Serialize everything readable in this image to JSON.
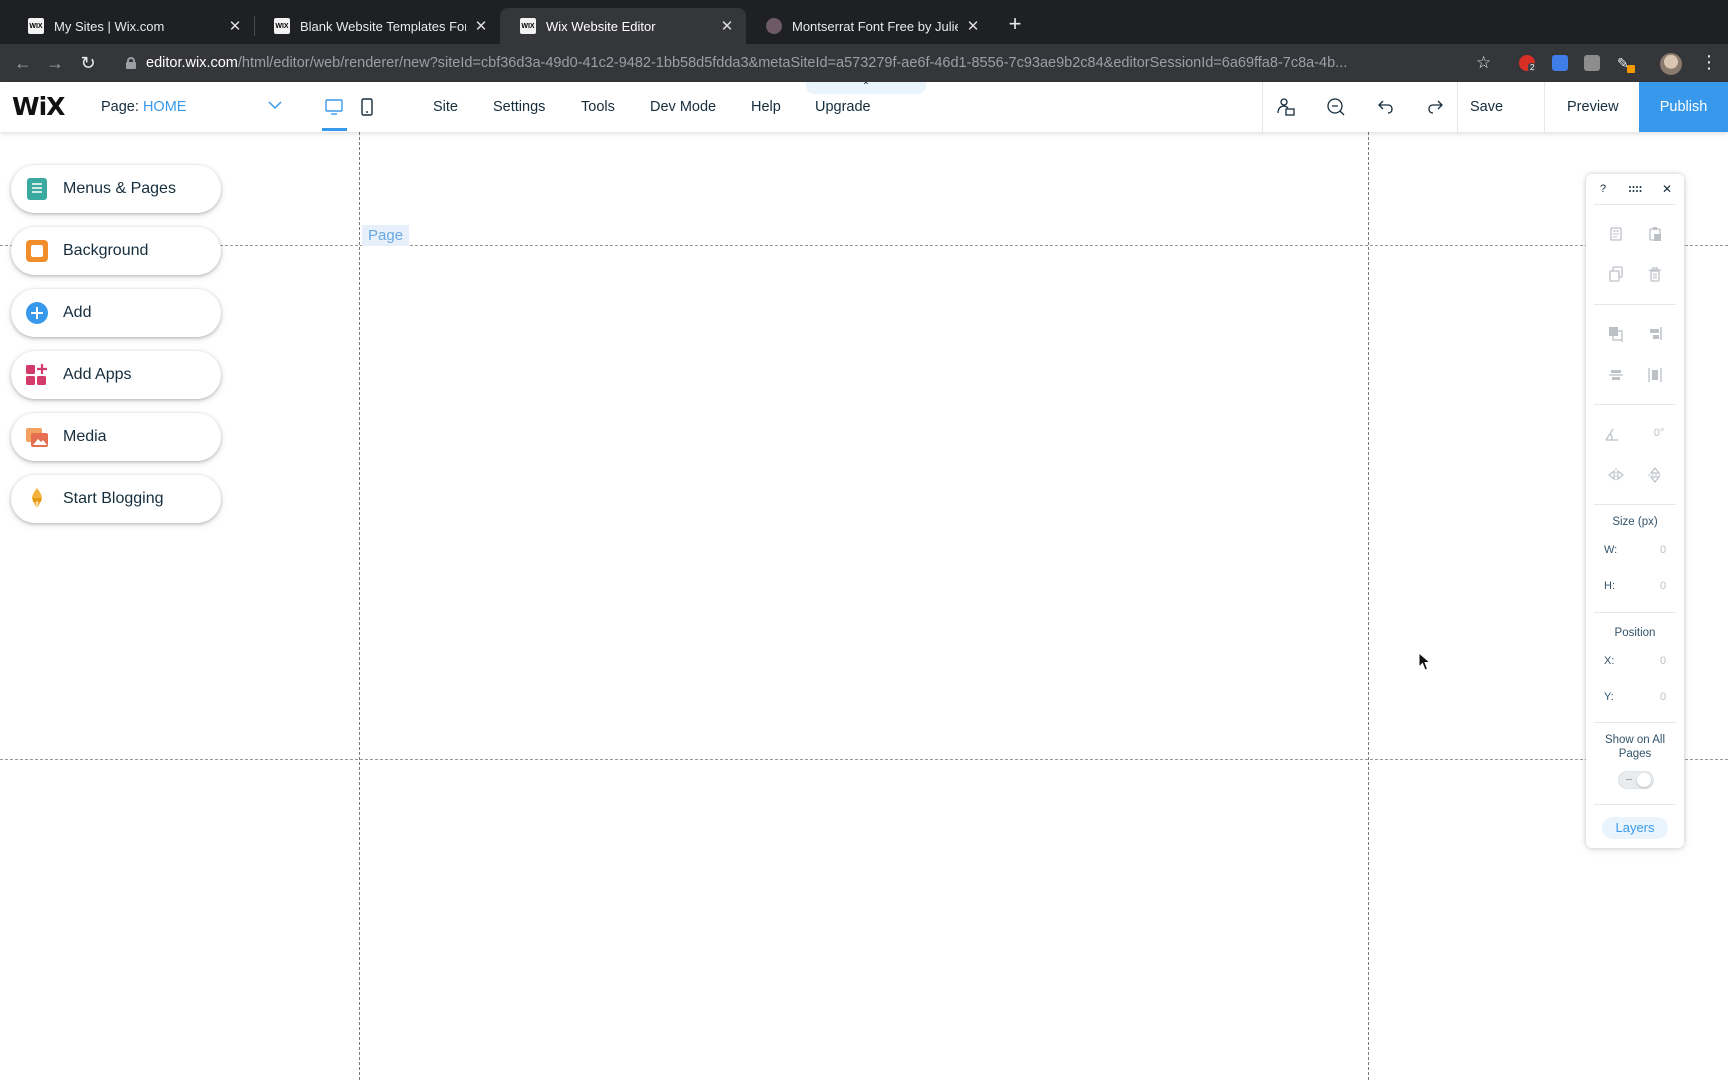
{
  "browser": {
    "tabs": [
      {
        "title": "My Sites | Wix.com",
        "favicon": "WIX"
      },
      {
        "title": "Blank Website Templates For C",
        "favicon": "WIX"
      },
      {
        "title": "Wix Website Editor",
        "favicon": "WIX"
      },
      {
        "title": "Montserrat Font Free by Julieta",
        "favicon": ""
      }
    ],
    "active_tab": 2,
    "url_host": "editor.wix.com",
    "url_path": "/html/editor/web/renderer/new?siteId=cbf36d3a-49d0-41c2-9482-1bb58d5fdda3&metaSiteId=a573279f-ae6f-46d1-8556-7c93ae9b2c84&editorSessionId=6a69ffa8-7c8a-4b...",
    "extension_badge": "2"
  },
  "editor": {
    "logo": "WiX",
    "page_label": "Page:",
    "page_name": "HOME",
    "menu": [
      "Site",
      "Settings",
      "Tools",
      "Dev Mode",
      "Help",
      "Upgrade"
    ],
    "save": "Save",
    "preview": "Preview",
    "publish": "Publish"
  },
  "left_panel": [
    {
      "label": "Menus & Pages",
      "icon": "menus-pages-icon"
    },
    {
      "label": "Background",
      "icon": "background-icon"
    },
    {
      "label": "Add",
      "icon": "add-icon"
    },
    {
      "label": "Add Apps",
      "icon": "add-apps-icon"
    },
    {
      "label": "Media",
      "icon": "media-icon"
    },
    {
      "label": "Start Blogging",
      "icon": "start-blogging-icon"
    }
  ],
  "canvas": {
    "page_label": "Page"
  },
  "inspector": {
    "help": "?",
    "rotation": "0°",
    "size_title": "Size (px)",
    "w_label": "W:",
    "w_value": "0",
    "h_label": "H:",
    "h_value": "0",
    "position_title": "Position",
    "x_label": "X:",
    "x_value": "0",
    "y_label": "Y:",
    "y_value": "0",
    "show_on_all_pages": "Show on All Pages",
    "layers": "Layers"
  },
  "colors": {
    "accent": "#3899ec",
    "text": "#162d3d",
    "browser_dark": "#1f2023",
    "browser_toolbar": "#35363a"
  }
}
